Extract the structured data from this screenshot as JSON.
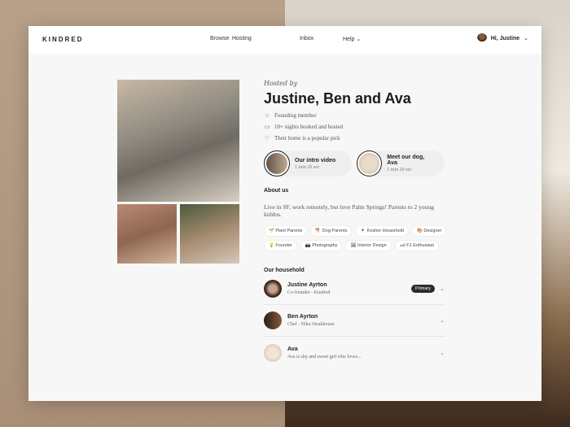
{
  "nav": {
    "logo": "KINDRED",
    "links": [
      "Browse",
      "Hosting",
      "Inbox",
      "Help"
    ],
    "greeting": "Hi, Justine"
  },
  "profile": {
    "hosted_by": "Hosted by",
    "title": "Justine, Ben and Ava",
    "features": [
      {
        "icon": "star-icon",
        "text": "Founding member"
      },
      {
        "icon": "suitcase-icon",
        "text": "10+ nights booked and hosted"
      },
      {
        "icon": "heart-icon",
        "text": "Their home is a popular pick"
      }
    ],
    "media": [
      {
        "title": "Our intro video",
        "duration": "1 min 20 sec"
      },
      {
        "title": "Meet our dog, Ava",
        "duration": "1 min 20 sec"
      }
    ]
  },
  "about": {
    "heading": "About us",
    "text": "Live in SF, work remotely, but love Palm Springs! Parents to 2 young kiddos.",
    "tags": [
      "🌱 Plant Parents",
      "🐕 Dog Parents",
      "🍷 Kosher Household",
      "🎨 Designer",
      "💡 Founder",
      "📷 Photography",
      "🖼 Interior Design",
      "🏎 F1 Enthusiast"
    ]
  },
  "household": {
    "heading": "Our household",
    "members": [
      {
        "name": "Justine Ayrton",
        "sub": "Co-founder - Kindred",
        "badge": "Primary"
      },
      {
        "name": "Ben Ayrton",
        "sub": "Chef - Niku Steakhouse"
      },
      {
        "name": "Ava",
        "sub": "Ava is shy and sweet girl who loves..."
      }
    ]
  }
}
